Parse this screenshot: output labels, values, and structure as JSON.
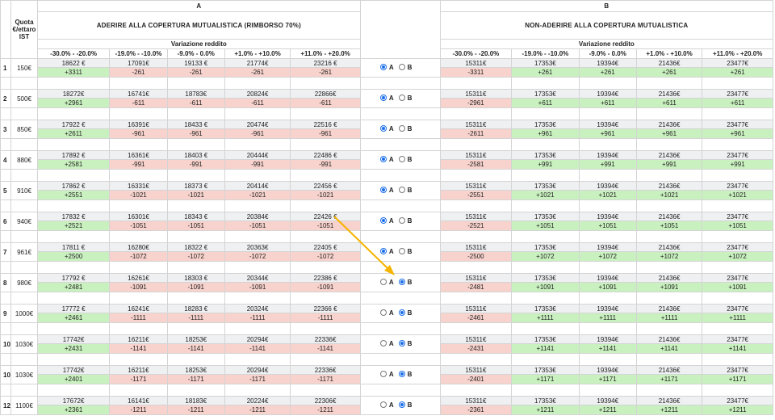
{
  "header": {
    "col_a": "A",
    "col_b": "B",
    "quota_label": "Quota €/ettaro IST",
    "title_a": "ADERIRE ALLA COPERTURA MUTUALISTICA (RIMBORSO 70%)",
    "title_b": "NON-ADERIRE ALLA COPERTURA MUTUALISTICA",
    "variation_a": "Variazione reddito",
    "variation_b": "Variazione reddito",
    "ranges": [
      "-30.0% - -20.0%",
      "-19.0% - -10.0%",
      "-9.0% - 0.0%",
      "+1.0% - +10.0%",
      "+11.0% - +20.0%"
    ]
  },
  "options": {
    "a": "A",
    "b": "B"
  },
  "colors": {
    "positive": "#c9f1bf",
    "negative": "#f8d2cc",
    "radio_selected": "#1a6ee8",
    "arrow": "#f5b400"
  },
  "rows": [
    {
      "idx": "1",
      "quota": "150€",
      "a_top": [
        "18622 €",
        "17091€",
        "19133 €",
        "21774€",
        "23216 €"
      ],
      "a_bot": [
        "+3311",
        "-261",
        "-261",
        "-261",
        "-261"
      ],
      "choice": "A",
      "b_top": [
        "15311€",
        "17353€",
        "19394€",
        "21436€",
        "23477€"
      ],
      "b_bot": [
        "-3311",
        "+261",
        "+261",
        "+261",
        "+261"
      ]
    },
    {
      "idx": "2",
      "quota": "500€",
      "a_top": [
        "18272€",
        "16741€",
        "18783€",
        "20824€",
        "22866€"
      ],
      "a_bot": [
        "+2961",
        "-611",
        "-611",
        "-611",
        "-611"
      ],
      "choice": "A",
      "b_top": [
        "15311€",
        "17353€",
        "19394€",
        "21436€",
        "23477€"
      ],
      "b_bot": [
        "-2961",
        "+611",
        "+611",
        "+611",
        "+611"
      ]
    },
    {
      "idx": "3",
      "quota": "850€",
      "a_top": [
        "17922 €",
        "16391€",
        "18433 €",
        "20474€",
        "22516 €"
      ],
      "a_bot": [
        "+2611",
        "-961",
        "-961",
        "-961",
        "-961"
      ],
      "choice": "A",
      "b_top": [
        "15311€",
        "17353€",
        "19394€",
        "21436€",
        "23477€"
      ],
      "b_bot": [
        "-2611",
        "+961",
        "+961",
        "+961",
        "+961"
      ]
    },
    {
      "idx": "4",
      "quota": "880€",
      "a_top": [
        "17892 €",
        "16361€",
        "18403 €",
        "20444€",
        "22486 €"
      ],
      "a_bot": [
        "+2581",
        "-991",
        "-991",
        "-991",
        "-991"
      ],
      "choice": "A",
      "b_top": [
        "15311€",
        "17353€",
        "19394€",
        "21436€",
        "23477€"
      ],
      "b_bot": [
        "-2581",
        "+991",
        "+991",
        "+991",
        "+991"
      ]
    },
    {
      "idx": "5",
      "quota": "910€",
      "a_top": [
        "17862 €",
        "16331€",
        "18373 €",
        "20414€",
        "22456 €"
      ],
      "a_bot": [
        "+2551",
        "-1021",
        "-1021",
        "-1021",
        "-1021"
      ],
      "choice": "A",
      "b_top": [
        "15311€",
        "17353€",
        "19394€",
        "21436€",
        "23477€"
      ],
      "b_bot": [
        "-2551",
        "+1021",
        "+1021",
        "+1021",
        "+1021"
      ]
    },
    {
      "idx": "6",
      "quota": "940€",
      "a_top": [
        "17832 €",
        "16301€",
        "18343 €",
        "20384€",
        "22426 €"
      ],
      "a_bot": [
        "+2521",
        "-1051",
        "-1051",
        "-1051",
        "-1051"
      ],
      "choice": "A",
      "b_top": [
        "15311€",
        "17353€",
        "19394€",
        "21436€",
        "23477€"
      ],
      "b_bot": [
        "-2521",
        "+1051",
        "+1051",
        "+1051",
        "+1051"
      ]
    },
    {
      "idx": "7",
      "quota": "961€",
      "a_top": [
        "17811 €",
        "16280€",
        "18322 €",
        "20363€",
        "22405 €"
      ],
      "a_bot": [
        "+2500",
        "-1072",
        "-1072",
        "-1072",
        "-1072"
      ],
      "choice": "A",
      "b_top": [
        "15311€",
        "17353€",
        "19394€",
        "21436€",
        "23477€"
      ],
      "b_bot": [
        "-2500",
        "+1072",
        "+1072",
        "+1072",
        "+1072"
      ]
    },
    {
      "idx": "8",
      "quota": "980€",
      "a_top": [
        "17792 €",
        "16261€",
        "18303 €",
        "20344€",
        "22386 €"
      ],
      "a_bot": [
        "+2481",
        "-1091",
        "-1091",
        "-1091",
        "-1091"
      ],
      "choice": "B",
      "b_top": [
        "15311€",
        "17353€",
        "19394€",
        "21436€",
        "23477€"
      ],
      "b_bot": [
        "-2481",
        "+1091",
        "+1091",
        "+1091",
        "+1091"
      ]
    },
    {
      "idx": "9",
      "quota": "1000€",
      "a_top": [
        "17772 €",
        "16241€",
        "18283 €",
        "20324€",
        "22366 €"
      ],
      "a_bot": [
        "+2461",
        "-1111",
        "-1111",
        "-1111",
        "-1111"
      ],
      "choice": "B",
      "b_top": [
        "15311€",
        "17353€",
        "19394€",
        "21436€",
        "23477€"
      ],
      "b_bot": [
        "-2461",
        "+1111",
        "+1111",
        "+1111",
        "+1111"
      ]
    },
    {
      "idx": "10",
      "quota": "1030€",
      "a_top": [
        "17742€",
        "16211€",
        "18253€",
        "20294€",
        "22336€"
      ],
      "a_bot": [
        "+2431",
        "-1141",
        "-1141",
        "-1141",
        "-1141"
      ],
      "choice": "B",
      "b_top": [
        "15311€",
        "17353€",
        "19394€",
        "21436€",
        "23477€"
      ],
      "b_bot": [
        "-2431",
        "+1141",
        "+1141",
        "+1141",
        "+1141"
      ]
    },
    {
      "idx": "10",
      "quota": "1030€",
      "a_top": [
        "17742€",
        "16211€",
        "18253€",
        "20294€",
        "22336€"
      ],
      "a_bot": [
        "+2401",
        "-1171",
        "-1171",
        "-1171",
        "-1171"
      ],
      "choice": "B",
      "b_top": [
        "15311€",
        "17353€",
        "19394€",
        "21436€",
        "23477€"
      ],
      "b_bot": [
        "-2401",
        "+1171",
        "+1171",
        "+1171",
        "+1171"
      ]
    },
    {
      "idx": "12",
      "quota": "1100€",
      "a_top": [
        "17672€",
        "16141€",
        "18183€",
        "20224€",
        "22306€"
      ],
      "a_bot": [
        "+2361",
        "-1211",
        "-1211",
        "-1211",
        "-1211"
      ],
      "choice": "B",
      "b_top": [
        "15311€",
        "17353€",
        "19394€",
        "21436€",
        "23477€"
      ],
      "b_bot": [
        "-2361",
        "+1211",
        "+1211",
        "+1211",
        "+1211"
      ]
    }
  ]
}
